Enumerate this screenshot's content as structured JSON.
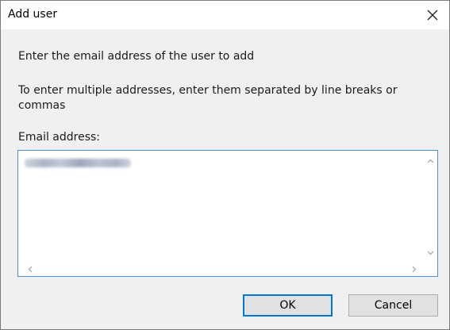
{
  "dialog": {
    "title": "Add user",
    "close_icon": "close-icon"
  },
  "content": {
    "prompt": "Enter the email address of the user to add",
    "multi_hint": "To enter multiple addresses, enter them separated by line breaks or commas",
    "email_label": "Email address:"
  },
  "scrollbars": {
    "up_icon": "chevron-up-icon",
    "down_icon": "chevron-down-icon",
    "left_icon": "chevron-left-icon",
    "right_icon": "chevron-right-icon"
  },
  "buttons": {
    "ok_label": "OK",
    "cancel_label": "Cancel"
  },
  "colors": {
    "focus_accent": "#0078d7",
    "textbox_border": "#4a90d9",
    "dialog_background": "#f0f0f0"
  }
}
